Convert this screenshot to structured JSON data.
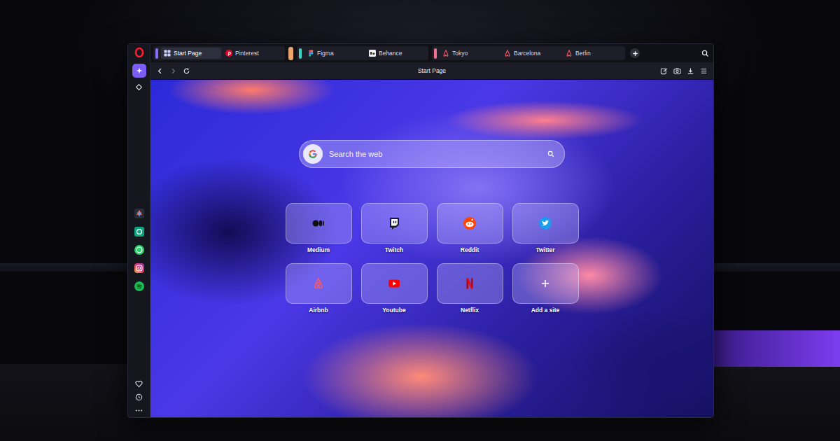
{
  "address_bar": {
    "title": "Start Page"
  },
  "tab_groups": [
    {
      "color": "#8b6cf6",
      "collapsed": false,
      "tabs": [
        {
          "label": "Start Page",
          "selected": true
        },
        {
          "label": "Pinterest",
          "selected": false
        }
      ]
    },
    {
      "color": "#e8a56c",
      "collapsed": true,
      "tabs": []
    },
    {
      "color": "#3fd3c4",
      "collapsed": false,
      "tabs": [
        {
          "label": "Figma",
          "selected": false
        },
        {
          "label": "Behance",
          "selected": false
        }
      ]
    },
    {
      "color": "#f0708f",
      "collapsed": false,
      "tabs": [
        {
          "label": "Tokyo",
          "selected": false
        },
        {
          "label": "Barcelona",
          "selected": false
        },
        {
          "label": "Berlin",
          "selected": false
        }
      ]
    }
  ],
  "search": {
    "placeholder": "Search the web"
  },
  "speed_dials": [
    {
      "label": "Medium"
    },
    {
      "label": "Twitch"
    },
    {
      "label": "Reddit"
    },
    {
      "label": "Twitter"
    },
    {
      "label": "Airbnb"
    },
    {
      "label": "Youtube"
    },
    {
      "label": "Netflix"
    },
    {
      "label": "Add a site"
    }
  ]
}
